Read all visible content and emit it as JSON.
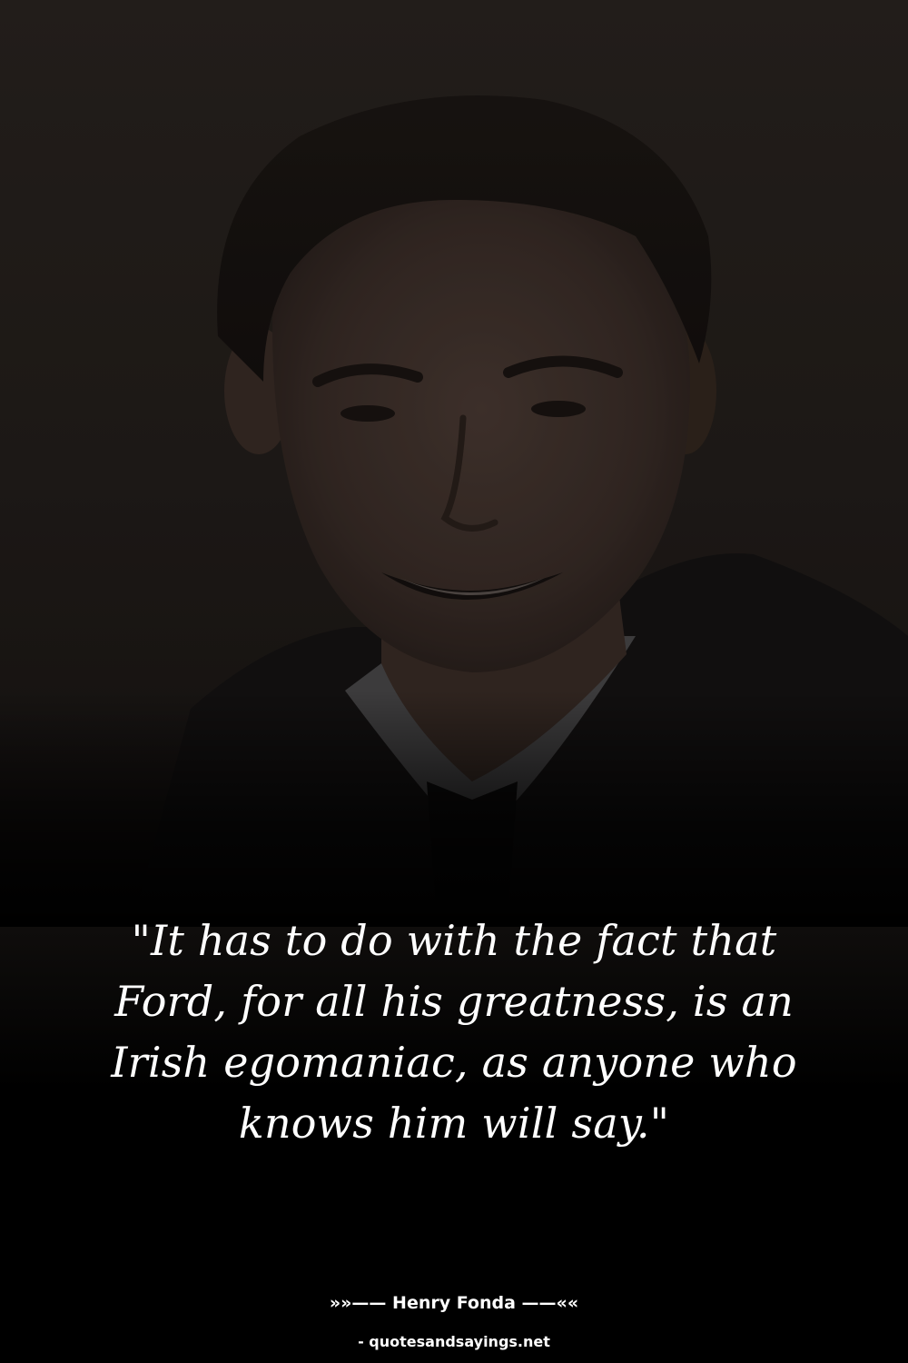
{
  "quote": {
    "text": "\"It has to do with the fact that Ford, for all his greatness, is an Irish egomaniac, as anyone who knows him will say.\""
  },
  "attribution": {
    "author_line": "»»—— Henry Fonda ——««"
  },
  "watermark": {
    "text": "- quotesandsayings.net"
  },
  "colors": {
    "background": "#000000",
    "text": "#ffffff",
    "photo_tint": "#2a2420"
  }
}
